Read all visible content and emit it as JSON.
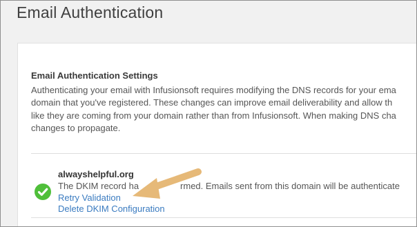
{
  "page": {
    "title": "Email Authentication"
  },
  "settings": {
    "title": "Email Authentication Settings",
    "description_lines": [
      "Authenticating your email with Infusionsoft requires modifying the DNS records for your ema",
      "domain that you've registered. These changes can improve email deliverability and allow th",
      "like they are coming from your domain rather than from Infusionsoft. When making DNS cha",
      "changes to propagate."
    ]
  },
  "domain": {
    "name": "alwayshelpful.org",
    "status_visible_prefix": "The DKIM record ha",
    "status_visible_suffix": "rmed. Emails sent from this domain will be authenticate",
    "retry_label": "Retry Validation",
    "delete_label": "Delete DKIM Configuration",
    "status_icon": "check-circle-icon",
    "status_color": "#4fbf3a"
  },
  "annotation": {
    "arrow_color": "#e6b978"
  }
}
